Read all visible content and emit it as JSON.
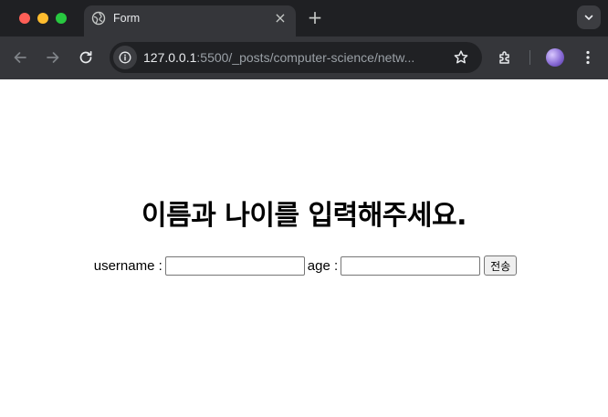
{
  "browser": {
    "tab": {
      "title": "Form",
      "favicon": "globe-icon"
    },
    "address": {
      "host": "127.0.0.1",
      "path": ":5500/_posts/computer-science/netw..."
    },
    "icons": {
      "back": "arrow-left-icon",
      "forward": "arrow-right-icon",
      "reload": "reload-icon",
      "site_info": "info-icon",
      "bookmark": "star-icon",
      "extensions": "puzzle-icon",
      "menu": "kebab-menu-icon",
      "tab_search": "chevron-down-icon",
      "new_tab": "+",
      "tab_close": "×"
    },
    "colors": {
      "tabbar_bg": "#1f2023",
      "toolbar_bg": "#35363a",
      "omnibox_bg": "#202124"
    }
  },
  "page": {
    "heading": "이름과 나이를 입력해주세요.",
    "form": {
      "username_label": "username :",
      "username_value": "",
      "age_label": "age :",
      "age_value": "",
      "submit_label": "전송"
    }
  }
}
